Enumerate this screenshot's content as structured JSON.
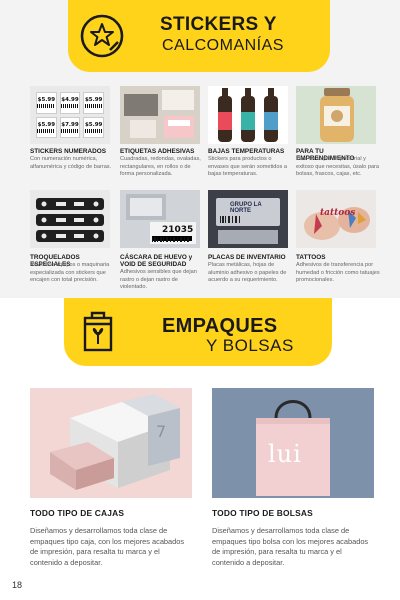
{
  "banner1": {
    "title": "STICKERS Y",
    "subtitle": "CALCOMANÍAS"
  },
  "banner2": {
    "title": "EMPAQUES",
    "subtitle": "Y BOLSAS"
  },
  "price_tags": [
    "$5.99",
    "$4.99",
    "$5.99",
    "$5.99",
    "$7.99",
    "$5.99"
  ],
  "labels_row2": {
    "egg_number": "21035",
    "plate_brand": "GRUPO LA NORTE"
  },
  "tattoo_text": "tattoos",
  "bag_logo": "lui",
  "box_number": "7",
  "stickers": [
    {
      "title": "STICKERS NUMERADOS",
      "text": "Con numeración numérica, alfanumérica y código de barras."
    },
    {
      "title": "ETIQUETAS ADHESIVAS",
      "text": "Cuadradas, redondas, ovaladas, rectangulares, en rollos o de forma personalizada."
    },
    {
      "title": "BAJAS TEMPERATURAS",
      "text": "Stickers para productos o envases que serán sometidos a bajas temperaturas."
    },
    {
      "title": "PARA TU EMPRENDIMIENTO",
      "text": "Dale un toque empresarial y exitoso que necesitas, úsalo para bolsas, frascos, cajas, etc."
    },
    {
      "title": "TROQUELADOS ESPECIALES",
      "text": "Revitalice equipos o maquinaria especializada con stickers que encajen con total precisión."
    },
    {
      "title": "CÁSCARA DE HUEVO y VOID DE SEGURIDAD",
      "text": "Adhesivos sensibles que dejan rastro o dejan rastro de violentado."
    },
    {
      "title": "PLACAS DE INVENTARIO",
      "text": "Placas metálicas, hojas de aluminio adhesivo o papeles de acuerdo a su requerimiento."
    },
    {
      "title": "TATTOOS",
      "text": "Adhesivos de transferencia por humedad o fricción como tatuajes promocionales."
    }
  ],
  "packaging": [
    {
      "title": "TODO TIPO DE CAJAS",
      "text": "Diseñamos y desarrollamos toda clase de empaques tipo caja, con los mejores acabados de impresión, para resalta tu marca y el contenido a depositar."
    },
    {
      "title": "TODO TIPO DE BOLSAS",
      "text": "Diseñamos y desarrollamos toda clase de empaques tipo bolsa con los mejores acabados de impresión, para resalta tu marca y el contenido a depositar."
    }
  ],
  "page_number": "18",
  "colors": {
    "accent": "#ffd31a",
    "background_top": "#f3f3f3",
    "text_dark": "#1a1a1a",
    "text_muted": "#666666"
  }
}
